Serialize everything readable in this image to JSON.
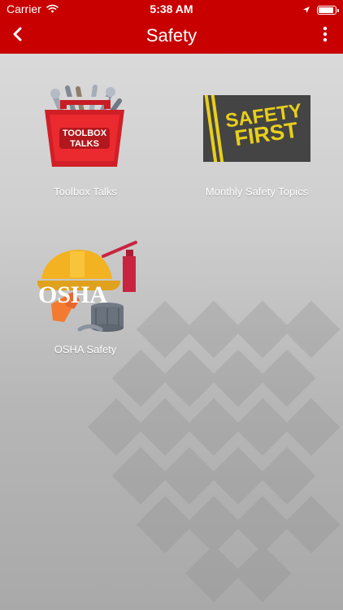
{
  "status_bar": {
    "carrier": "Carrier",
    "time": "5:38 AM"
  },
  "nav": {
    "title": "Safety"
  },
  "tiles": [
    {
      "label": "Toolbox Talks",
      "image_text": [
        "TOOLBOX",
        "TALKS"
      ]
    },
    {
      "label": "Monthly Safety Topics",
      "image_text": [
        "SAFETY",
        "FIRST"
      ]
    },
    {
      "label": "OSHA Safety",
      "image_text": [
        "OSHA"
      ]
    }
  ],
  "colors": {
    "header": "#c80000",
    "text": "#ffffff",
    "background_top": "#dddddd",
    "background_bottom": "#a9a9a9",
    "pattern": "#8c8c8c"
  },
  "icons": {
    "back": "chevron-left-icon",
    "more": "vertical-ellipsis-icon",
    "signal": "wifi-icon",
    "location": "location-arrow-icon",
    "battery": "battery-icon"
  }
}
